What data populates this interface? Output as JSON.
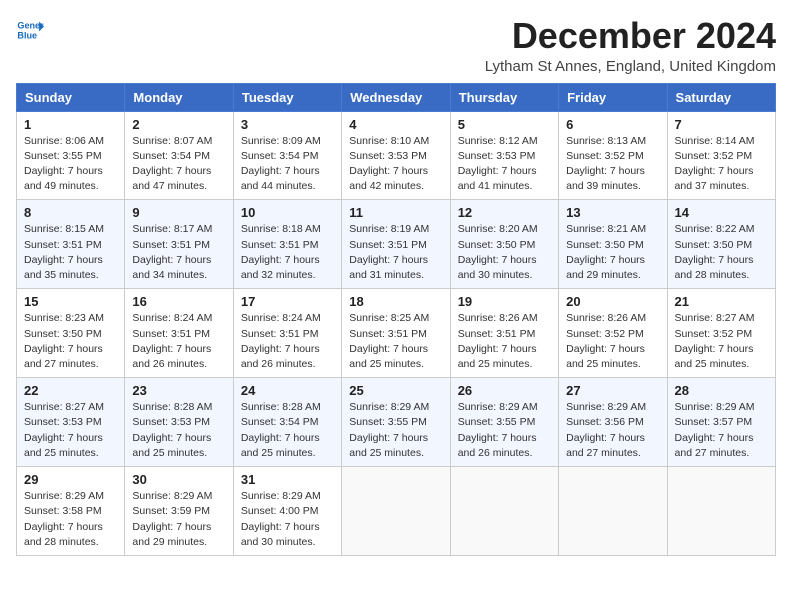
{
  "logo": {
    "line1": "General",
    "line2": "Blue",
    "icon_color": "#1a6bbd"
  },
  "title": "December 2024",
  "subtitle": "Lytham St Annes, England, United Kingdom",
  "headers": [
    "Sunday",
    "Monday",
    "Tuesday",
    "Wednesday",
    "Thursday",
    "Friday",
    "Saturday"
  ],
  "weeks": [
    [
      {
        "day": "1",
        "sunrise": "8:06 AM",
        "sunset": "3:55 PM",
        "daylight": "7 hours and 49 minutes."
      },
      {
        "day": "2",
        "sunrise": "8:07 AM",
        "sunset": "3:54 PM",
        "daylight": "7 hours and 47 minutes."
      },
      {
        "day": "3",
        "sunrise": "8:09 AM",
        "sunset": "3:54 PM",
        "daylight": "7 hours and 44 minutes."
      },
      {
        "day": "4",
        "sunrise": "8:10 AM",
        "sunset": "3:53 PM",
        "daylight": "7 hours and 42 minutes."
      },
      {
        "day": "5",
        "sunrise": "8:12 AM",
        "sunset": "3:53 PM",
        "daylight": "7 hours and 41 minutes."
      },
      {
        "day": "6",
        "sunrise": "8:13 AM",
        "sunset": "3:52 PM",
        "daylight": "7 hours and 39 minutes."
      },
      {
        "day": "7",
        "sunrise": "8:14 AM",
        "sunset": "3:52 PM",
        "daylight": "7 hours and 37 minutes."
      }
    ],
    [
      {
        "day": "8",
        "sunrise": "8:15 AM",
        "sunset": "3:51 PM",
        "daylight": "7 hours and 35 minutes."
      },
      {
        "day": "9",
        "sunrise": "8:17 AM",
        "sunset": "3:51 PM",
        "daylight": "7 hours and 34 minutes."
      },
      {
        "day": "10",
        "sunrise": "8:18 AM",
        "sunset": "3:51 PM",
        "daylight": "7 hours and 32 minutes."
      },
      {
        "day": "11",
        "sunrise": "8:19 AM",
        "sunset": "3:51 PM",
        "daylight": "7 hours and 31 minutes."
      },
      {
        "day": "12",
        "sunrise": "8:20 AM",
        "sunset": "3:50 PM",
        "daylight": "7 hours and 30 minutes."
      },
      {
        "day": "13",
        "sunrise": "8:21 AM",
        "sunset": "3:50 PM",
        "daylight": "7 hours and 29 minutes."
      },
      {
        "day": "14",
        "sunrise": "8:22 AM",
        "sunset": "3:50 PM",
        "daylight": "7 hours and 28 minutes."
      }
    ],
    [
      {
        "day": "15",
        "sunrise": "8:23 AM",
        "sunset": "3:50 PM",
        "daylight": "7 hours and 27 minutes."
      },
      {
        "day": "16",
        "sunrise": "8:24 AM",
        "sunset": "3:51 PM",
        "daylight": "7 hours and 26 minutes."
      },
      {
        "day": "17",
        "sunrise": "8:24 AM",
        "sunset": "3:51 PM",
        "daylight": "7 hours and 26 minutes."
      },
      {
        "day": "18",
        "sunrise": "8:25 AM",
        "sunset": "3:51 PM",
        "daylight": "7 hours and 25 minutes."
      },
      {
        "day": "19",
        "sunrise": "8:26 AM",
        "sunset": "3:51 PM",
        "daylight": "7 hours and 25 minutes."
      },
      {
        "day": "20",
        "sunrise": "8:26 AM",
        "sunset": "3:52 PM",
        "daylight": "7 hours and 25 minutes."
      },
      {
        "day": "21",
        "sunrise": "8:27 AM",
        "sunset": "3:52 PM",
        "daylight": "7 hours and 25 minutes."
      }
    ],
    [
      {
        "day": "22",
        "sunrise": "8:27 AM",
        "sunset": "3:53 PM",
        "daylight": "7 hours and 25 minutes."
      },
      {
        "day": "23",
        "sunrise": "8:28 AM",
        "sunset": "3:53 PM",
        "daylight": "7 hours and 25 minutes."
      },
      {
        "day": "24",
        "sunrise": "8:28 AM",
        "sunset": "3:54 PM",
        "daylight": "7 hours and 25 minutes."
      },
      {
        "day": "25",
        "sunrise": "8:29 AM",
        "sunset": "3:55 PM",
        "daylight": "7 hours and 25 minutes."
      },
      {
        "day": "26",
        "sunrise": "8:29 AM",
        "sunset": "3:55 PM",
        "daylight": "7 hours and 26 minutes."
      },
      {
        "day": "27",
        "sunrise": "8:29 AM",
        "sunset": "3:56 PM",
        "daylight": "7 hours and 27 minutes."
      },
      {
        "day": "28",
        "sunrise": "8:29 AM",
        "sunset": "3:57 PM",
        "daylight": "7 hours and 27 minutes."
      }
    ],
    [
      {
        "day": "29",
        "sunrise": "8:29 AM",
        "sunset": "3:58 PM",
        "daylight": "7 hours and 28 minutes."
      },
      {
        "day": "30",
        "sunrise": "8:29 AM",
        "sunset": "3:59 PM",
        "daylight": "7 hours and 29 minutes."
      },
      {
        "day": "31",
        "sunrise": "8:29 AM",
        "sunset": "4:00 PM",
        "daylight": "7 hours and 30 minutes."
      },
      null,
      null,
      null,
      null
    ]
  ]
}
